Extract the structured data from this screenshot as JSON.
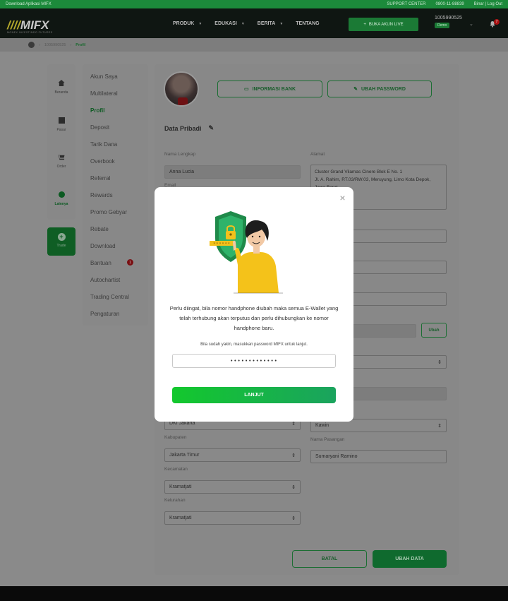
{
  "topbar": {
    "download": "Download Aplikasi MIFX",
    "support": "SUPPORT CENTER",
    "phone": "0800-11-88839",
    "user_links": "Binar | Log Out"
  },
  "navbar": {
    "logo": "MIFX",
    "logo_sub": "MONEX INVESTINDO FUTURES",
    "menu": [
      "PRODUK",
      "EDUKASI",
      "BERITA",
      "TENTANG"
    ],
    "live_button": "BUKA AKUN LIVE",
    "account_number": "1005990525",
    "account_badge": "Demo",
    "notification_count": "7"
  },
  "breadcrumb": {
    "account": "1005990525",
    "current": "Profil"
  },
  "left_nav": {
    "items": [
      "Beranda",
      "Pasar",
      "Order",
      "Lainnya"
    ],
    "trade": "Trade"
  },
  "submenu": {
    "items": [
      "Akun Saya",
      "Multilateral",
      "Profil",
      "Deposit",
      "Tarik Dana",
      "Overbook",
      "Referral",
      "Rewards",
      "Promo Gebyar",
      "Rebate",
      "Download",
      "Bantuan",
      "Autochartist",
      "Trading Central",
      "Pengaturan"
    ],
    "bantuan_badge": "1"
  },
  "profile": {
    "bank_button": "INFORMASI BANK",
    "password_button": "UBAH PASSWORD",
    "section_title": "Data Pribadi",
    "nama_label": "Nama Lengkap",
    "nama_value": "Anna Lucia",
    "email_label": "Email",
    "alamat_label": "Alamat",
    "alamat_value": "Cluster Grand Vilamas Cinere Blok E No. 1\nJl. A. Rahim, RT.03/RW.03, Meruyung, Limo Kota Depok, Jawa Barat.",
    "phone_ubah": "Ubah",
    "provinsi_value": "DKI Jakarta",
    "kabupaten_label": "Kabupaten",
    "kabupaten_value": "Jakarta Timur",
    "kecamatan_label": "Kecamatan",
    "kecamatan_value": "Kramatjati",
    "kelurahan_label": "Kelurahan",
    "kelurahan_value": "Kramatjati",
    "status_value": "Kawin",
    "pasangan_label": "Nama Pasangan",
    "pasangan_value": "Sumaryani Ramino",
    "batal": "BATAL",
    "ubah_data": "UBAH DATA"
  },
  "modal": {
    "message": "Perlu diingat, bila nomor handphone diubah maka semua E-Wallet yang telah terhubung akan terputus dan perlu dihubungkan ke nomor handphone baru.",
    "hint": "Bila sudah yakin, masukkan password MIFX untuk lanjut.",
    "password_value": "•••••••••••••",
    "button": "LANJUT",
    "illustration_dots": "* * * * * *"
  }
}
